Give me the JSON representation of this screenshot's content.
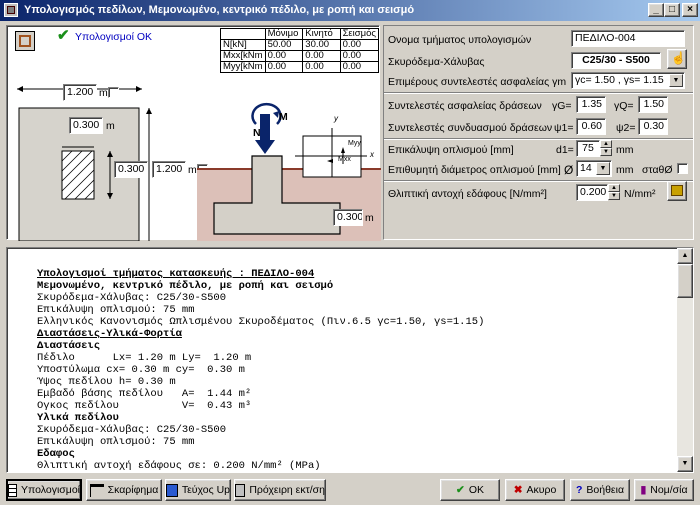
{
  "window": {
    "title": "Υπολογισμός πεδίλων, Μεμονωμένο, κεντρικό πέδιλο, με ροπή και σεισμό",
    "controls": [
      "_",
      "□",
      "×"
    ]
  },
  "status": {
    "text": "Υπολογισμοί OK"
  },
  "loads_table": {
    "headers": [
      "",
      "Μόνιμο",
      "Κινητό",
      "Σεισμός"
    ],
    "rows": [
      [
        "N[kN]",
        "50.00",
        "30.00",
        "0.00"
      ],
      [
        "Mxx[kNm",
        "0.00",
        "0.00",
        "0.00"
      ],
      [
        "Myy[kNm",
        "0.00",
        "0.00",
        "0.00"
      ]
    ]
  },
  "plan": {
    "lx": "1.200",
    "lx_unit": "m",
    "cx": "0.300",
    "cx_unit": "m",
    "cy": "0.300",
    "ly": "1.200",
    "ly_unit": "m"
  },
  "section": {
    "n_label": "N",
    "m_label": "M",
    "h": "0.300",
    "h_unit": "m",
    "axis_y": "y",
    "axis_x": "x",
    "myy": "Myy",
    "mxx": "Mxx"
  },
  "form": {
    "part_name_label": "Ονομα τμήματος υπολογισμών",
    "part_name_value": "ΠΕΔΙΛΟ-004",
    "material_label": "Σκυρόδεμα-Χάλυβας",
    "material_value": "C25/30 - S500",
    "partial_factors_label": "Επιμέρους συντελεστές ασφαλείας γm",
    "partial_factors_value": "γc= 1.50 , γs= 1.15",
    "action_factors_label": "Συντελεστές ασφαλείας δράσεων",
    "gG_label": "γG=",
    "gG_value": "1.35",
    "gQ_label": "γQ=",
    "gQ_value": "1.50",
    "combo_factors_label": "Συντελεστές συνδυασμού δράσεων",
    "psi1_label": "ψ1=",
    "psi1_value": "0.60",
    "psi2_label": "ψ2=",
    "psi2_value": "0.30",
    "cover_label": "Επικάλυψη οπλισμού [mm]",
    "d1_label": "d1=",
    "d1_value": "75",
    "d1_unit": "mm",
    "diameter_label": "Επιθυμητή διάμετρος οπλισμού [mm]",
    "diameter_symbol": "Ø",
    "diameter_value": "14",
    "diameter_unit": "mm",
    "const_label": "σταθØ",
    "soil_label": "Θλιπτική αντοχή εδάφους [N/mm²]",
    "soil_value": "0.200",
    "soil_unit": "N/mm²"
  },
  "report_lines": [
    {
      "cls": "u",
      "text": "Υπολογισμοί τμήματος κατασκευής : ΠΕΔΙΛΟ-004"
    },
    {
      "cls": "h",
      "text": "Μεμονωμένο, κεντρικό πέδιλο, με ροπή και σεισμό"
    },
    {
      "cls": "",
      "text": "Σκυρόδεμα-Χάλυβας: C25/30-S500"
    },
    {
      "cls": "",
      "text": "Επικάλυψη οπλισμού: 75 mm"
    },
    {
      "cls": "",
      "text": "Ελληνικός Κανονισμός Ωπλισμένου Σκυροδέματος (Πιν.6.5 γc=1.50, γs=1.15)"
    },
    {
      "cls": "u",
      "text": "Διαστάσεις-Υλικά-Φορτία"
    },
    {
      "cls": "h",
      "text": "Διαστάσεις"
    },
    {
      "cls": "",
      "text": "Πέδιλο      Lx= 1.20 m Ly=  1.20 m"
    },
    {
      "cls": "",
      "text": "Υποστύλωμα cx= 0.30 m cy=  0.30 m"
    },
    {
      "cls": "",
      "text": "Ύψος πεδίλου h= 0.30 m"
    },
    {
      "cls": "",
      "text": "Εμβαδό βάσης πεδίλου   A=  1.44 m²"
    },
    {
      "cls": "",
      "text": "Ογκος πεδίλου          V=  0.43 m³"
    },
    {
      "cls": "h",
      "text": "Υλικά πεδίλου"
    },
    {
      "cls": "",
      "text": "Σκυρόδεμα-Χάλυβας: C25/30-S500"
    },
    {
      "cls": "",
      "text": "Επικάλυψη οπλισμού: 75 mm"
    },
    {
      "cls": "h",
      "text": "Εδαφος"
    },
    {
      "cls": "",
      "text": "Θλιπτική αντοχή εδάφους σε: 0.200 N/mm² (MPa)"
    }
  ],
  "buttons": {
    "calcs": "Υπολογισμοί",
    "sketch": "Σκαρίφημα",
    "teuxos": "Τεύχος Up",
    "print": "Πρόχειρη εκτ/ση",
    "ok": "OK",
    "cancel": "Ακυρο",
    "help": "Βοήθεια",
    "calc": "Νομ/σία"
  }
}
